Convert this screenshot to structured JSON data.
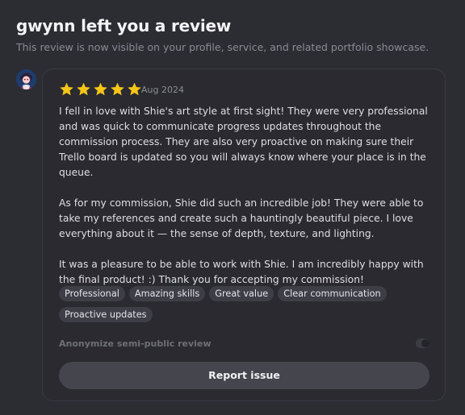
{
  "header": {
    "title": "gwynn left you a review",
    "subtitle": "This review is now visible on your profile, service, and related portfolio showcase."
  },
  "review": {
    "rating": 5,
    "max_rating": 5,
    "star_color": "#f5c518",
    "date": "Aug 2024",
    "paragraphs": [
      "I fell in love with Shie's art style at first sight! They were very professional and was quick to communicate progress updates throughout the commission process. They are also very proactive on making sure their Trello board is updated so you will always know where your place is in the queue.",
      "As for my commission, Shie did such an incredible job! They were able to take my references and create such a hauntingly beautiful piece. I love everything about it — the sense of depth, texture, and lighting.",
      "It was a pleasure to be able to work with Shie. I am incredibly happy with the final product! :) Thank you for accepting my commission!"
    ],
    "tags": [
      "Professional",
      "Amazing skills",
      "Great value",
      "Clear communication",
      "Proactive updates"
    ]
  },
  "anonymize": {
    "label": "Anonymize semi-public review",
    "enabled": false
  },
  "actions": {
    "report_label": "Report issue"
  }
}
